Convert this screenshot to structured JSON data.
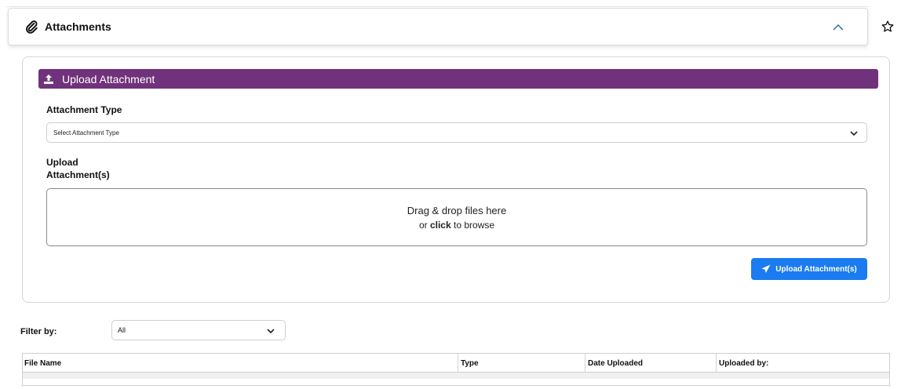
{
  "header": {
    "title": "Attachments",
    "icon": "paperclip-icon",
    "collapse_icon": "chevron-up-icon",
    "favorite_icon": "star-icon"
  },
  "upload": {
    "section_title": "Upload Attachment",
    "section_icon": "upload-icon",
    "attachment_type_label": "Attachment Type",
    "attachment_type_selected": "Select Attachment Type",
    "upload_label_line1": "Upload",
    "upload_label_line2": "Attachment(s)",
    "dropzone_line1": "Drag & drop files here",
    "dropzone_line2_prefix": "or ",
    "dropzone_line2_bold": "click",
    "dropzone_line2_suffix": " to browse",
    "button_label": "Upload Attachment(s)",
    "button_icon": "send-icon"
  },
  "filter": {
    "label": "Filter by:",
    "selected": "All"
  },
  "table": {
    "columns": [
      "File Name",
      "Type",
      "Date Uploaded",
      "Uploaded by:"
    ]
  },
  "colors": {
    "accent_purple": "#70327a",
    "button_blue": "#1a7cf0",
    "collapse_blue": "#2a6fb3"
  }
}
